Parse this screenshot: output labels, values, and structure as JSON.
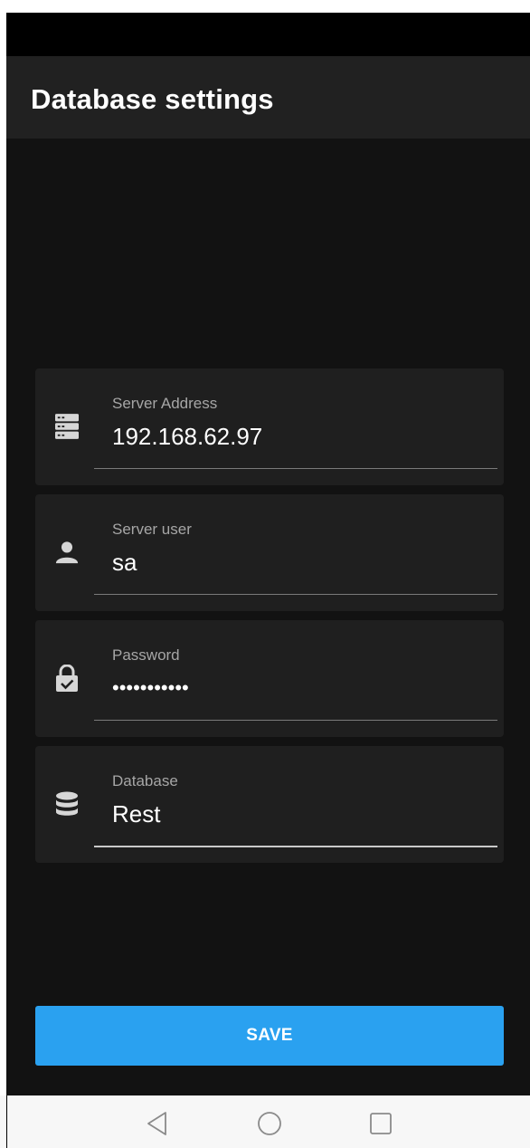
{
  "app_bar": {
    "title": "Database settings"
  },
  "fields": [
    {
      "label": "Server Address",
      "value": "192.168.62.97",
      "icon": "server-icon"
    },
    {
      "label": "Server user",
      "value": "sa",
      "icon": "person-icon"
    },
    {
      "label": "Password",
      "value": "•••••••••••",
      "icon": "lock-check-icon"
    },
    {
      "label": "Database",
      "value": "Rest",
      "icon": "database-icon"
    }
  ],
  "actions": {
    "save_label": "SAVE"
  },
  "nav": {
    "back": "back-icon",
    "home": "home-icon",
    "recents": "recents-icon"
  },
  "colors": {
    "accent": "#2aa1f0",
    "background": "#121212",
    "surface": "#1f1f1f",
    "app_bar": "#212121"
  }
}
